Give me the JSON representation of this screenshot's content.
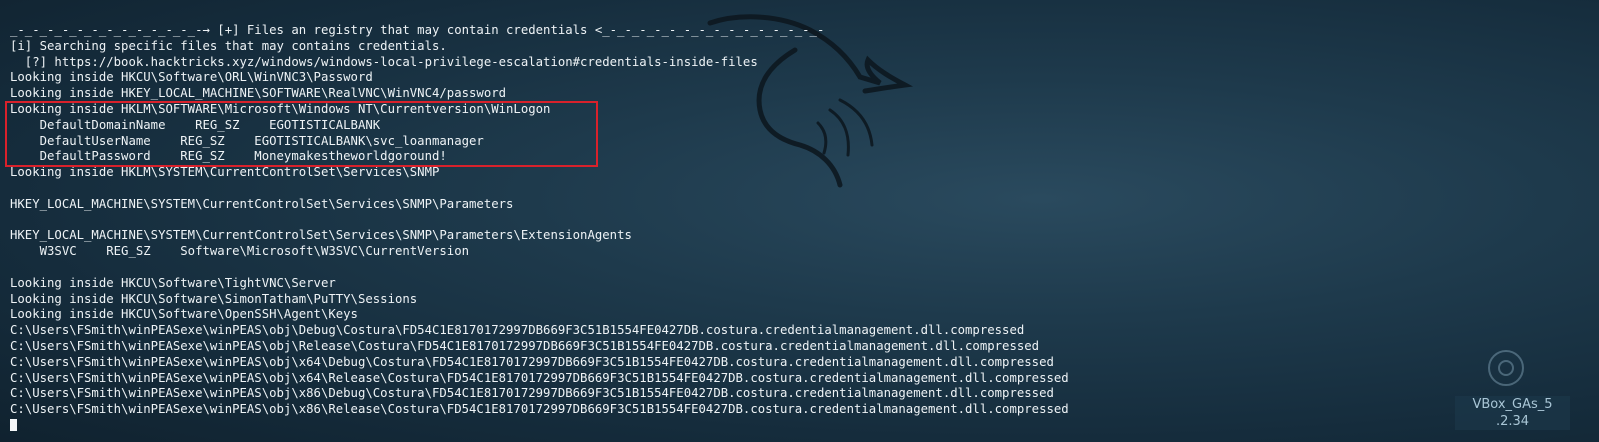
{
  "terminal": {
    "lines": [
      "_-_-_-_-_-_-_-_-_-_-_-_-_-→ [+] Files an registry that may contain credentials <_-_-_-_-_-_-_-_-_-_-_-_-_-_-_-",
      "[i] Searching specific files that may contains credentials.",
      "  [?] https://book.hacktricks.xyz/windows/windows-local-privilege-escalation#credentials-inside-files",
      "Looking inside HKCU\\Software\\ORL\\WinVNC3\\Password",
      "Looking inside HKEY_LOCAL_MACHINE\\SOFTWARE\\RealVNC\\WinVNC4/password",
      "Looking inside HKLM\\SOFTWARE\\Microsoft\\Windows NT\\Currentversion\\WinLogon",
      "    DefaultDomainName    REG_SZ    EGOTISTICALBANK",
      "    DefaultUserName    REG_SZ    EGOTISTICALBANK\\svc_loanmanager",
      "    DefaultPassword    REG_SZ    Moneymakestheworldgoround!",
      "Looking inside HKLM\\SYSTEM\\CurrentControlSet\\Services\\SNMP",
      "",
      "HKEY_LOCAL_MACHINE\\SYSTEM\\CurrentControlSet\\Services\\SNMP\\Parameters",
      "",
      "HKEY_LOCAL_MACHINE\\SYSTEM\\CurrentControlSet\\Services\\SNMP\\Parameters\\ExtensionAgents",
      "    W3SVC    REG_SZ    Software\\Microsoft\\W3SVC\\CurrentVersion",
      "",
      "Looking inside HKCU\\Software\\TightVNC\\Server",
      "Looking inside HKCU\\Software\\SimonTatham\\PuTTY\\Sessions",
      "Looking inside HKCU\\Software\\OpenSSH\\Agent\\Keys",
      "C:\\Users\\FSmith\\winPEASexe\\winPEAS\\obj\\Debug\\Costura\\FD54C1E8170172997DB669F3C51B1554FE0427DB.costura.credentialmanagement.dll.compressed",
      "C:\\Users\\FSmith\\winPEASexe\\winPEAS\\obj\\Release\\Costura\\FD54C1E8170172997DB669F3C51B1554FE0427DB.costura.credentialmanagement.dll.compressed",
      "C:\\Users\\FSmith\\winPEASexe\\winPEAS\\obj\\x64\\Debug\\Costura\\FD54C1E8170172997DB669F3C51B1554FE0427DB.costura.credentialmanagement.dll.compressed",
      "C:\\Users\\FSmith\\winPEASexe\\winPEAS\\obj\\x64\\Release\\Costura\\FD54C1E8170172997DB669F3C51B1554FE0427DB.costura.credentialmanagement.dll.compressed",
      "C:\\Users\\FSmith\\winPEASexe\\winPEAS\\obj\\x86\\Debug\\Costura\\FD54C1E8170172997DB669F3C51B1554FE0427DB.costura.credentialmanagement.dll.compressed",
      "C:\\Users\\FSmith\\winPEASexe\\winPEAS\\obj\\x86\\Release\\Costura\\FD54C1E8170172997DB669F3C51B1554FE0427DB.costura.credentialmanagement.dll.compressed"
    ]
  },
  "overlay": {
    "vbox_label_line1": "VBox_GAs_5",
    "vbox_label_line2": ".2.34"
  },
  "colors": {
    "highlight_border": "#d9212b",
    "terminal_text": "#eef3f6",
    "background": "#1e3a4c"
  },
  "icons": {
    "background_logo": "kali-dragon-icon",
    "vbox": "virtualbox-icon"
  }
}
